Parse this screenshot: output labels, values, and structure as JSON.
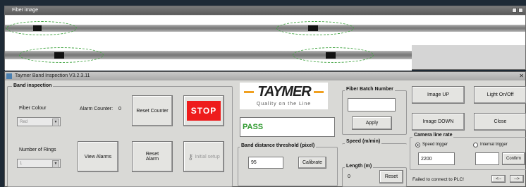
{
  "fiber_window": {
    "title": "Fiber image"
  },
  "main_window": {
    "title": "Taymer Band Inspection V3.2.3.11"
  },
  "band_inspection": {
    "group_label": "Band inspection",
    "fiber_colour_label": "Fiber Colour",
    "fiber_colour_value": "Red",
    "alarm_counter_label": "Alarm Counter:",
    "alarm_counter_value": "0",
    "reset_counter": "Reset Counter",
    "stop": "STOP",
    "rings_label": "Number of Rings",
    "rings_value": "1",
    "view_alarms": "View Alarms",
    "reset_alarm": "Reset\nAlarm",
    "initial_setup": "Initial setup"
  },
  "logo": {
    "name": "TAYMER",
    "tagline": "Quality on the Line"
  },
  "status": {
    "text": "PASS",
    "color": "#2f9a2f"
  },
  "threshold": {
    "label": "Band distance threshold (pixel)",
    "value": "95",
    "calibrate": "Calibrate"
  },
  "batch": {
    "label": "Fiber Batch Number",
    "value": "",
    "apply": "Apply"
  },
  "speed": {
    "label": "Speed (m/min)"
  },
  "length": {
    "label": "Length (m)",
    "value": "0",
    "reset": "Reset"
  },
  "controls": {
    "image_up": "Image UP",
    "light": "Light On/Off",
    "image_down": "Image DOWN",
    "close": "Close"
  },
  "camera": {
    "label": "Camera line rate",
    "speed_trigger": "Speed trigger",
    "internal_trigger": "Internal trigger",
    "rate_value": "2200",
    "internal_value": "",
    "confirm": "Confirm"
  },
  "footer": {
    "message": "Failed to connect to PLC!",
    "prev": "<--",
    "next": "-->"
  },
  "colors": {
    "stop": "#ee1c1c",
    "logo_orange": "#f0a020",
    "pass_bg": "#ffffff"
  }
}
